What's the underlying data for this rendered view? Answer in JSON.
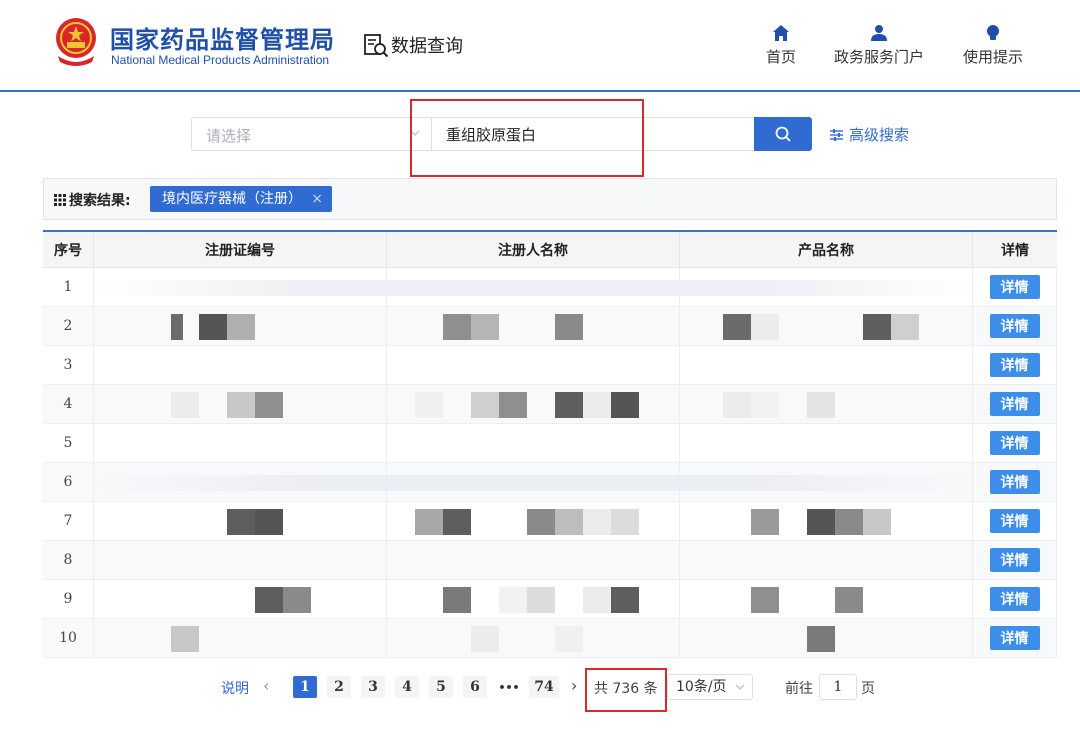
{
  "header": {
    "brand_cn": "国家药品监督管理局",
    "brand_en": "National Medical Products Administration",
    "section_title": "数据查询",
    "nav": [
      {
        "label": "首页",
        "icon": "home-icon"
      },
      {
        "label": "政务服务门户",
        "icon": "user-icon"
      },
      {
        "label": "使用提示",
        "icon": "lightbulb-icon"
      }
    ],
    "colors": {
      "brand": "#1f4fa8",
      "accent": "#2f6bd0",
      "highlight": "#d22c2c"
    }
  },
  "search": {
    "select_placeholder": "请选择",
    "query_value": "重组胶原蛋白",
    "advanced_label": "高级搜索"
  },
  "result": {
    "label": "搜索结果:",
    "tag": "境内医疗器械（注册）"
  },
  "table": {
    "headers": [
      "序号",
      "注册证编号",
      "注册人名称",
      "产品名称",
      "详情"
    ],
    "detail_label": "详情",
    "rows": [
      {
        "idx": "1"
      },
      {
        "idx": "2"
      },
      {
        "idx": "3"
      },
      {
        "idx": "4"
      },
      {
        "idx": "5"
      },
      {
        "idx": "6"
      },
      {
        "idx": "7"
      },
      {
        "idx": "8"
      },
      {
        "idx": "9"
      },
      {
        "idx": "10"
      }
    ]
  },
  "pagination": {
    "explain": "说明",
    "pages": [
      "1",
      "2",
      "3",
      "4",
      "5",
      "6",
      "74"
    ],
    "ellipsis": "•••",
    "current": "1",
    "total": "共 736 条",
    "page_size": "10条/页",
    "goto_prefix": "前往",
    "goto_value": "1",
    "goto_suffix": "页"
  }
}
